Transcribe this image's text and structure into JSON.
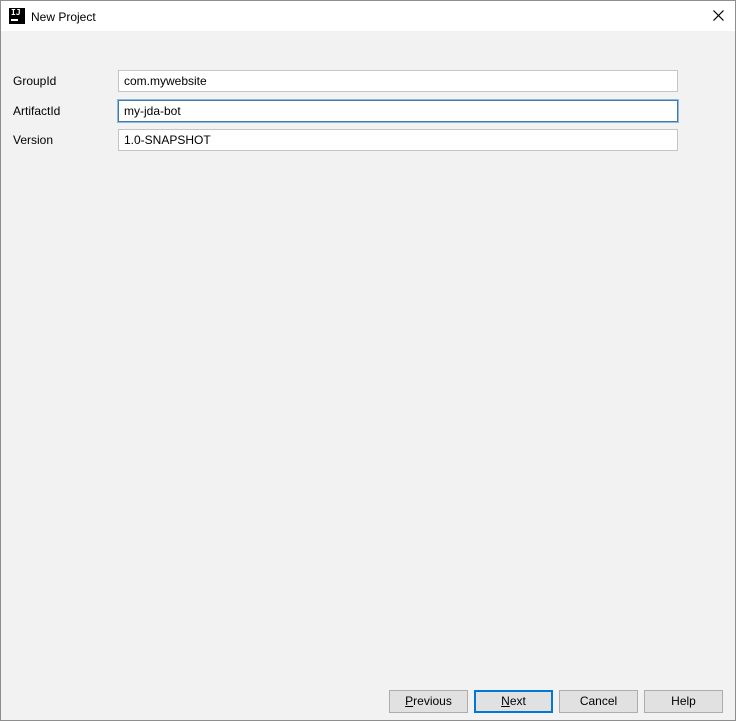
{
  "window": {
    "title": "New Project",
    "app_icon": "intellij-idea-icon",
    "close_icon": "close-icon"
  },
  "form": {
    "fields": [
      {
        "label": "GroupId",
        "value": "com.mywebsite"
      },
      {
        "label": "ArtifactId",
        "value": "my-jda-bot"
      },
      {
        "label": "Version",
        "value": "1.0-SNAPSHOT"
      }
    ]
  },
  "buttons": {
    "previous": {
      "mnemonic": "P",
      "rest": "revious"
    },
    "next": {
      "mnemonic": "N",
      "rest": "ext"
    },
    "cancel": "Cancel",
    "help": "Help"
  },
  "colors": {
    "dialog_background": "#f2f2f2",
    "focus_border": "#3d7bb0",
    "default_button_border": "#0078d7"
  }
}
